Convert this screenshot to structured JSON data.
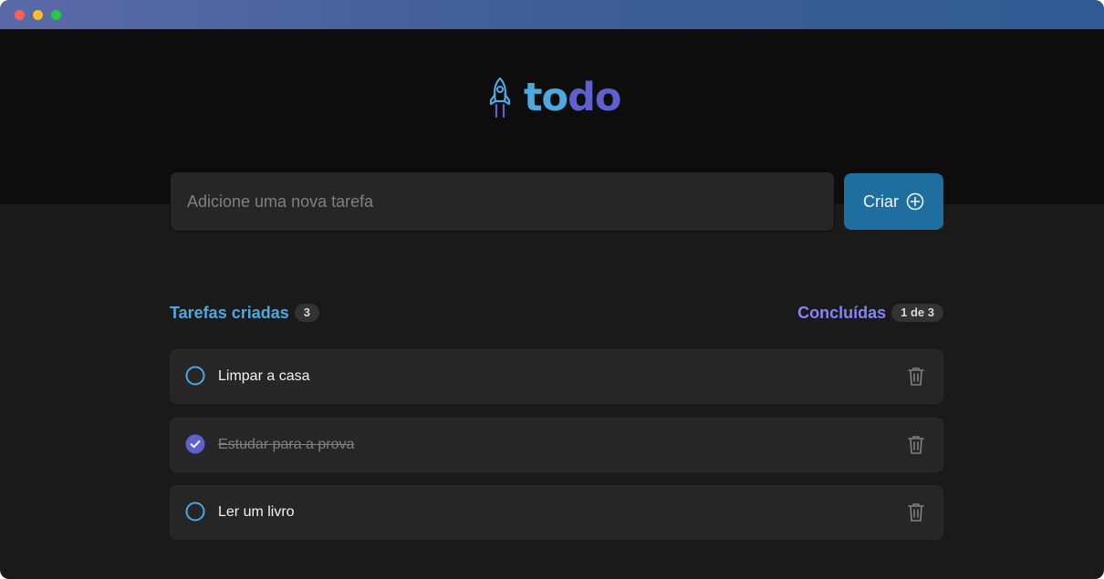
{
  "app": {
    "logo_part1": "to",
    "logo_part2": "do"
  },
  "new_task": {
    "placeholder": "Adicione uma nova tarefa",
    "button_label": "Criar"
  },
  "summary": {
    "created_label": "Tarefas criadas",
    "created_count": "3",
    "done_label": "Concluídas",
    "done_count": "1 de 3"
  },
  "tasks": [
    {
      "text": "Limpar a casa",
      "completed": false
    },
    {
      "text": "Estudar para a prova",
      "completed": true
    },
    {
      "text": "Ler um livro",
      "completed": false
    }
  ],
  "colors": {
    "blue": "#4ea8de",
    "purple": "#5e60ce",
    "purple_light": "#8284fa",
    "button": "#1e6f9f",
    "background": "#1a1a1a",
    "header_bg": "#0d0d0d",
    "card": "#262626"
  },
  "icons": {
    "logo": "rocket-icon",
    "create": "plus-circle-icon",
    "unchecked": "circle-icon",
    "checked": "check-circle-icon",
    "delete": "trash-icon"
  }
}
